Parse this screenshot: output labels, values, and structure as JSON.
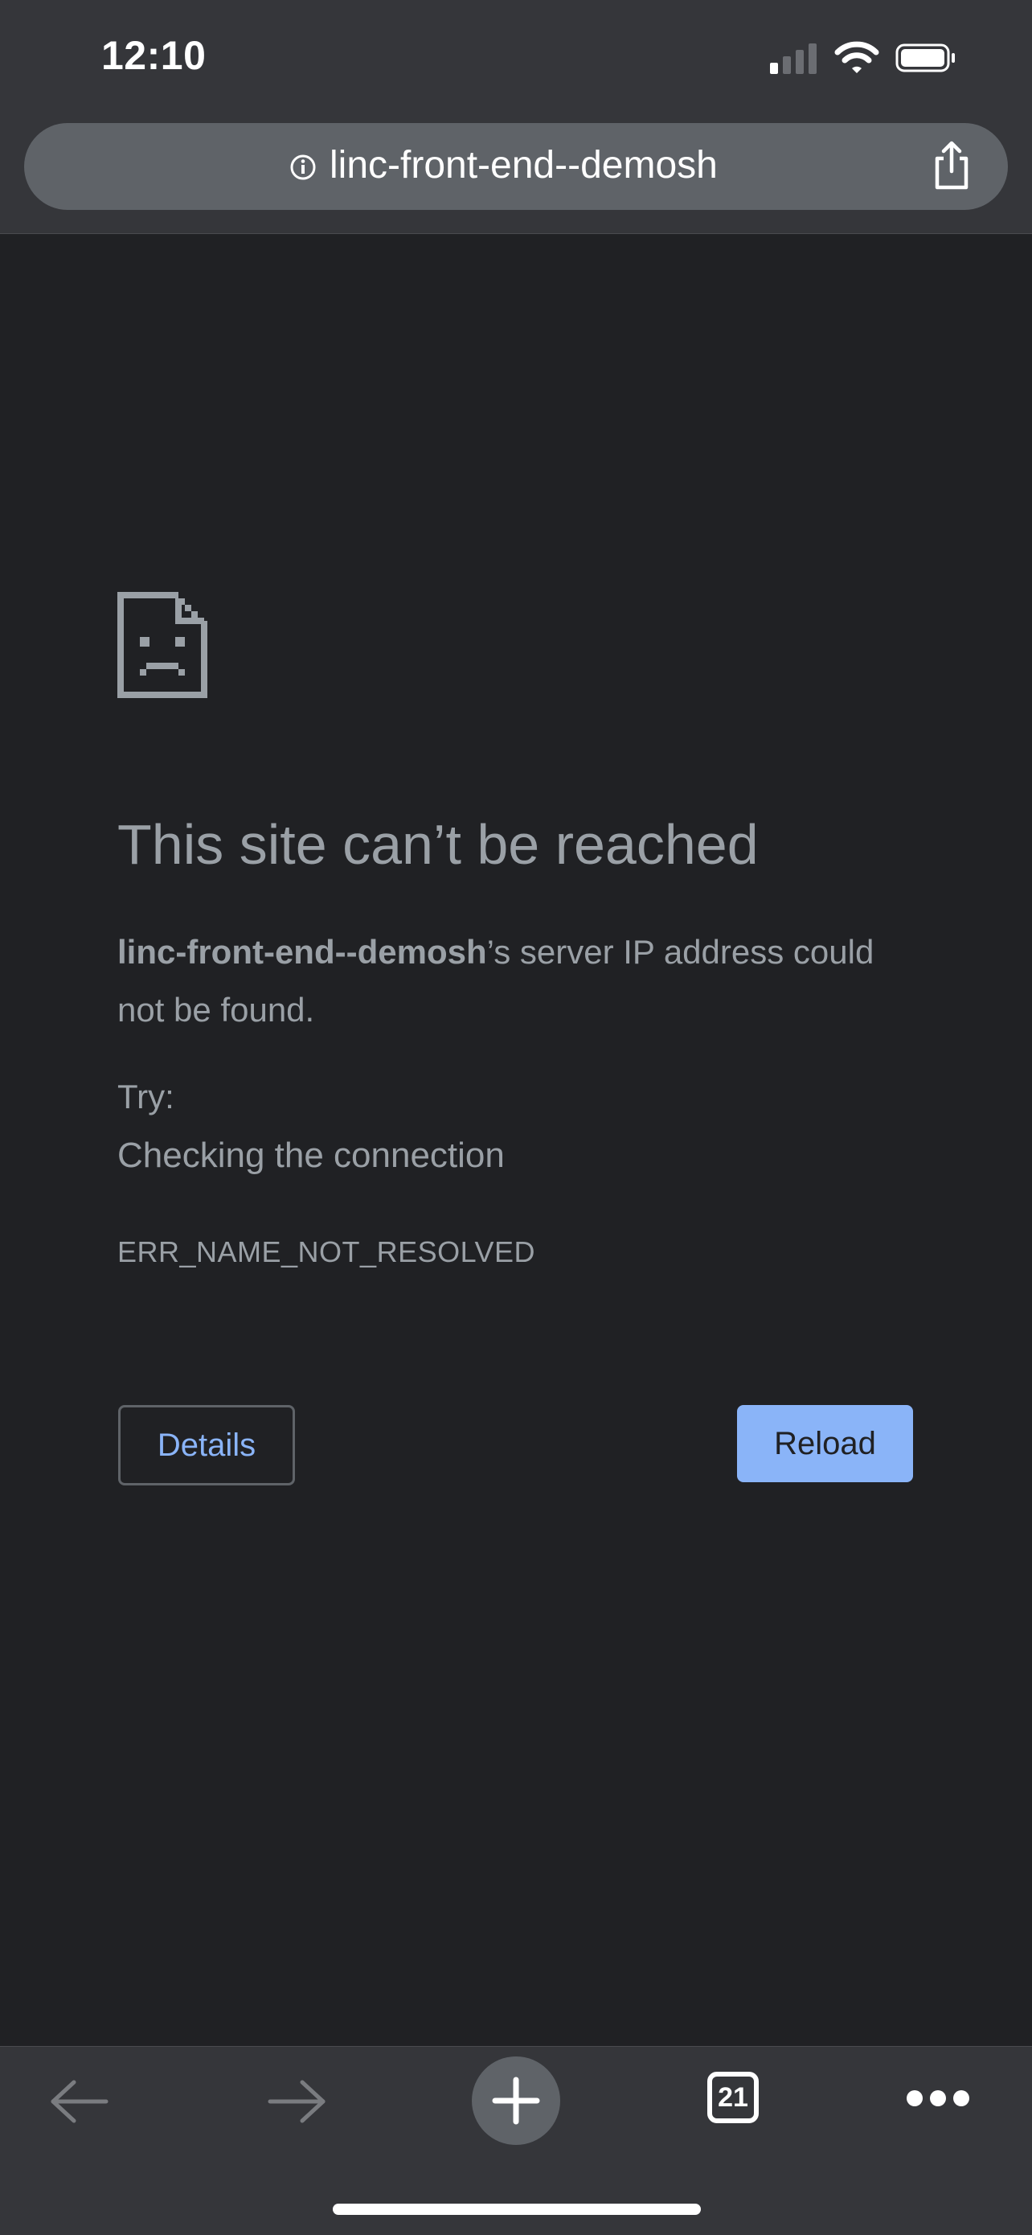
{
  "status_bar": {
    "time": "12:10",
    "signal_icon": "cellular-signal-icon",
    "wifi_icon": "wifi-icon",
    "battery_icon": "battery-icon"
  },
  "address_bar": {
    "url": "linc-front-end--demosh",
    "info_icon": "info-icon",
    "share_icon": "share-icon"
  },
  "error_page": {
    "icon": "sad-page-icon",
    "title": "This site can’t be reached",
    "host": "linc-front-end--demosh",
    "description_suffix": "’s server IP address could not be found.",
    "try_label": "Try:",
    "suggestion": "Checking the connection",
    "error_code": "ERR_NAME_NOT_RESOLVED",
    "details_label": "Details",
    "reload_label": "Reload"
  },
  "toolbar": {
    "back_icon": "back-arrow-icon",
    "forward_icon": "forward-arrow-icon",
    "new_tab_icon": "plus-icon",
    "tab_count": "21",
    "menu_icon": "more-icon"
  },
  "colors": {
    "background": "#202124",
    "chrome": "#35363a",
    "text": "#9aa0a6",
    "accent": "#8ab4f8"
  }
}
